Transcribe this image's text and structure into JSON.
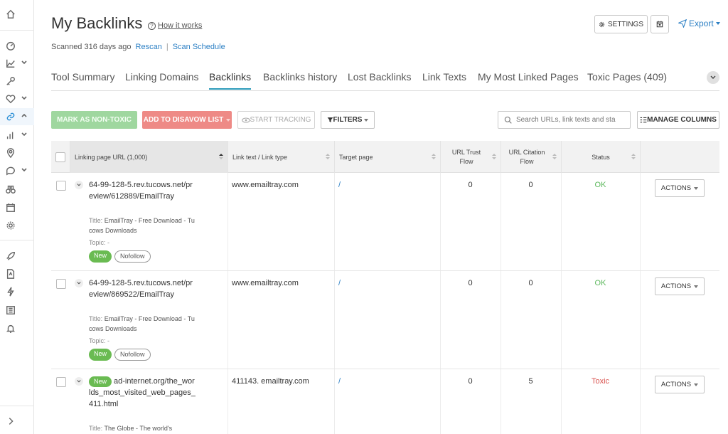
{
  "header": {
    "title": "My Backlinks",
    "how_it_works": "How it works",
    "scanned": "Scanned 316 days ago",
    "rescan": "Rescan",
    "separator": "|",
    "scan_schedule": "Scan Schedule",
    "settings": "SETTINGS",
    "export": "Export"
  },
  "tabs": [
    {
      "label": "Tool Summary"
    },
    {
      "label": "Linking Domains"
    },
    {
      "label": "Backlinks"
    },
    {
      "label": "Backlinks history"
    },
    {
      "label": "Lost Backlinks"
    },
    {
      "label": "Link Texts"
    },
    {
      "label": "My Most Linked Pages"
    },
    {
      "label": "Toxic Pages (409)"
    }
  ],
  "toolbar": {
    "mark_non_toxic": "MARK AS NON-TOXIC",
    "add_disavow": "ADD TO DISAVOW LIST",
    "start_tracking": "START TRACKING",
    "filters": "FILTERS",
    "search_placeholder": "Search URLs, link texts and sta",
    "manage_columns": "MANAGE COLUMNS"
  },
  "table": {
    "headers": {
      "linking_page": "Linking page URL (1,000)",
      "link_text": "Link text / Link type",
      "target": "Target page",
      "trust_flow": "URL Trust Flow",
      "citation_flow": "URL Citation Flow",
      "status": "Status"
    },
    "rows": [
      {
        "url": "64-99-128-5.rev.tucows.net/preview/612889/EmailTray",
        "title_label": "Title:",
        "title": "EmailTray - Free Download - Tucows Downloads",
        "topic_label": "Topic:",
        "topic": "-",
        "tag_new": "New",
        "tag_nofollow": "Nofollow",
        "link_text": "www.emailtray.com",
        "target": "/",
        "trust_flow": "0",
        "citation_flow": "0",
        "status": "OK",
        "actions": "ACTIONS"
      },
      {
        "url": "64-99-128-5.rev.tucows.net/preview/869522/EmailTray",
        "title_label": "Title:",
        "title": "EmailTray - Free Download - Tucows Downloads",
        "topic_label": "Topic:",
        "topic": "-",
        "tag_new": "New",
        "tag_nofollow": "Nofollow",
        "link_text": "www.emailtray.com",
        "target": "/",
        "trust_flow": "0",
        "citation_flow": "0",
        "status": "OK",
        "actions": "ACTIONS"
      },
      {
        "url": "ad-internet.org/the_worlds_most_visited_web_pages_411.html",
        "title_label": "Title:",
        "title": "The Globe - The world's",
        "tag_new": "New",
        "link_text": "411143. emailtray.com",
        "target": "/",
        "trust_flow": "0",
        "citation_flow": "5",
        "status": "Toxic",
        "actions": "ACTIONS"
      }
    ]
  },
  "colors": {
    "accent": "#2b7fc4",
    "ok": "#5cb85c",
    "toxic": "#d9534f",
    "new": "#6abb52"
  }
}
